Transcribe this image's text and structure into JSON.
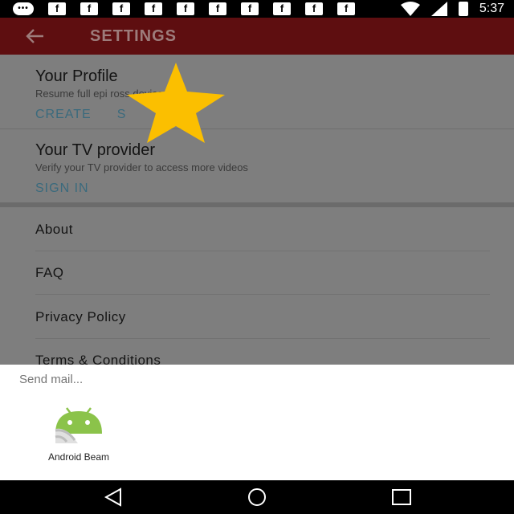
{
  "status_bar": {
    "time": "5:37",
    "notification_icons": [
      "message-icon",
      "facebook-icon",
      "facebook-icon",
      "facebook-icon",
      "facebook-icon",
      "facebook-icon",
      "facebook-icon",
      "facebook-icon",
      "facebook-icon",
      "facebook-icon",
      "facebook-icon"
    ],
    "facebook_glyph": "f",
    "message_glyph": "•••"
  },
  "app_bar": {
    "title": "SETTINGS",
    "background": "#5e0e10"
  },
  "profile": {
    "title": "Your Profile",
    "description": "Resume full epi                   ross devices",
    "actions": [
      "CREATE",
      "S"
    ]
  },
  "tv_provider": {
    "title": "Your TV provider",
    "description": "Verify your TV provider to access more videos",
    "action": "SIGN IN"
  },
  "menu": {
    "items": [
      "About",
      "FAQ",
      "Privacy Policy",
      "Terms & Conditions"
    ]
  },
  "share_sheet": {
    "title": "Send mail...",
    "apps": [
      {
        "label": "Android Beam",
        "icon": "android-beam-icon"
      }
    ]
  },
  "colors": {
    "accent_link": "#3a6a7d",
    "star": "#fbbf00",
    "android_green": "#8bc34a"
  }
}
